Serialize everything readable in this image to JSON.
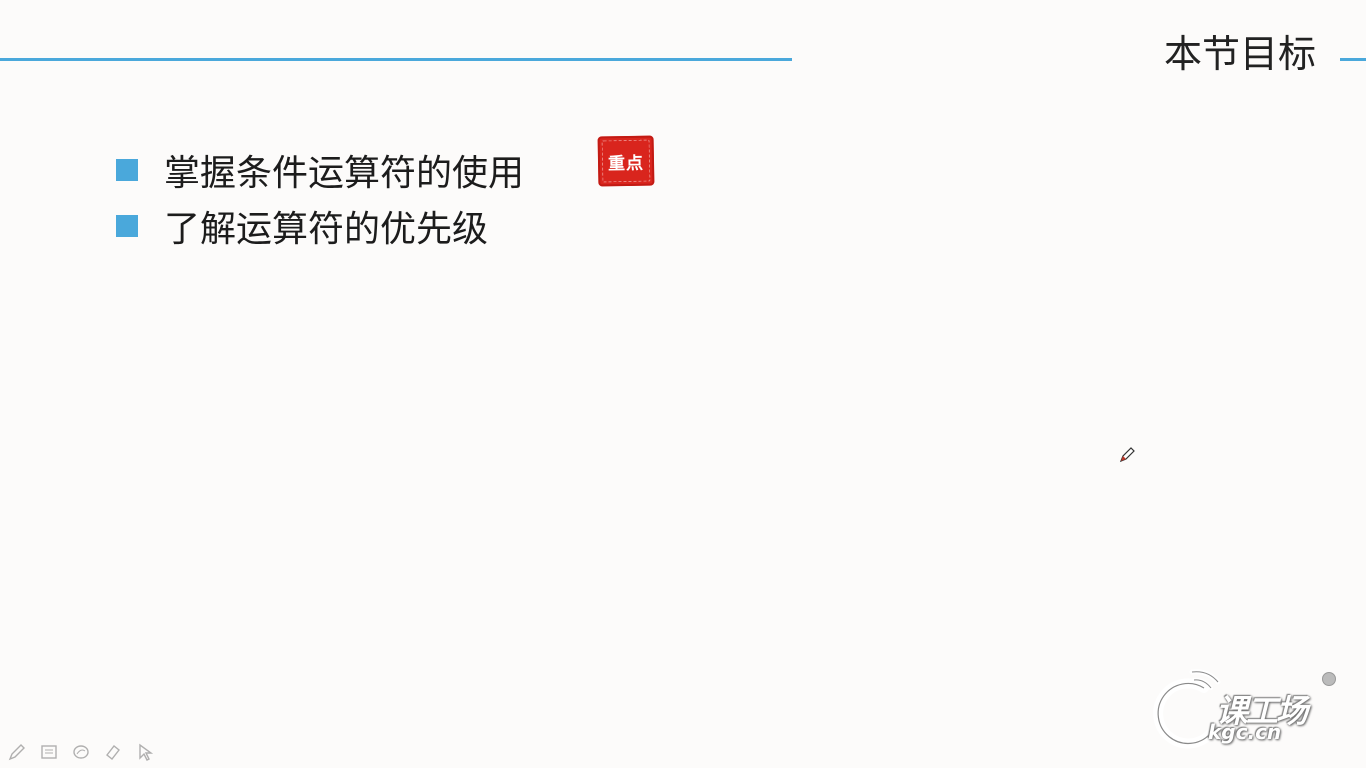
{
  "slide": {
    "title": "本节目标",
    "objectives": [
      {
        "text": "掌握条件运算符的使用",
        "badge": "重点"
      },
      {
        "text": "了解运算符的优先级"
      }
    ]
  },
  "toolbar": {
    "tools": [
      "pen-icon",
      "slides-icon",
      "ink-icon",
      "eraser-icon",
      "pointer-icon"
    ]
  },
  "logo": {
    "brand": "课工场",
    "domain": "kgc.cn"
  },
  "colors": {
    "accent": "#4aa8db",
    "stamp": "#d9251d",
    "background": "#fcfbfa"
  }
}
